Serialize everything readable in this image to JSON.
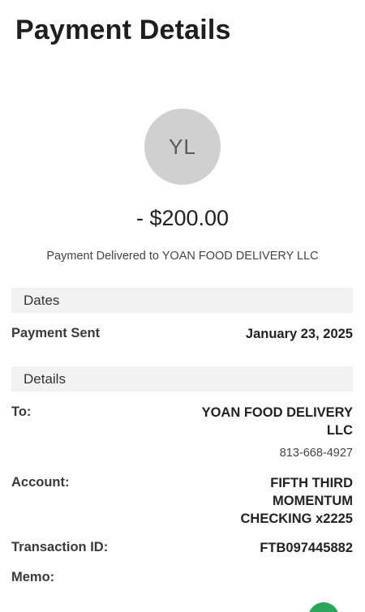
{
  "header": {
    "title": "Payment Details"
  },
  "payee": {
    "initials": "YL",
    "amount": "- $200.00",
    "status_text": "Payment Delivered to YOAN FOOD DELIVERY LLC"
  },
  "dates": {
    "section_label": "Dates",
    "payment_sent_label": "Payment Sent",
    "payment_sent_value": "January 23, 2025"
  },
  "details": {
    "section_label": "Details",
    "to_label": "To:",
    "to_value_line1": "YOAN FOOD DELIVERY",
    "to_value_line2": "LLC",
    "phone": "813-668-4927",
    "account_label": "Account:",
    "account_line1": "FIFTH THIRD",
    "account_line2": "MOMENTUM",
    "account_line3": "CHECKING x2225",
    "transaction_label": "Transaction ID:",
    "transaction_value": "FTB097445882",
    "memo_label": "Memo:"
  },
  "colors": {
    "avatar_bg": "#d0d0d0",
    "section_bg": "#f2f2f2",
    "fab": "#2aa65a"
  },
  "icons": {
    "fab": "chat-fab-icon"
  }
}
